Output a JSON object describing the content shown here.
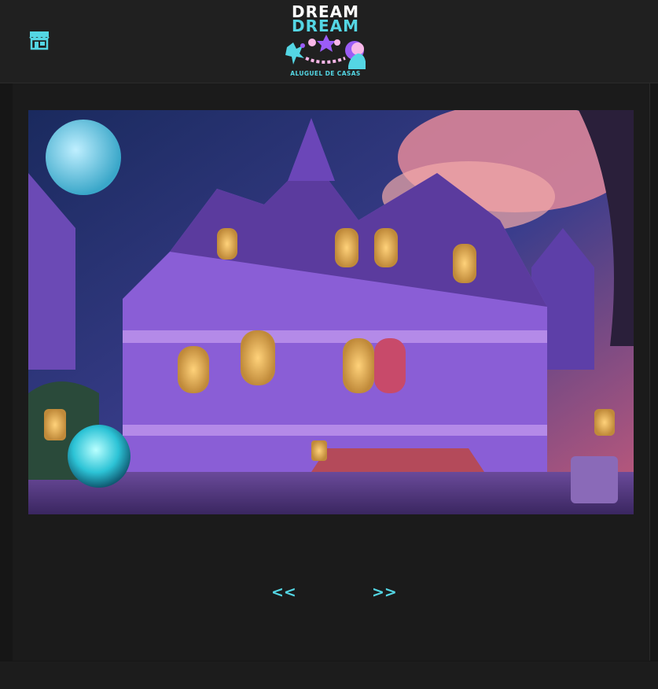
{
  "header": {
    "store_icon": "storefront-icon",
    "logo": {
      "line1": "DREAM",
      "line2": "DREAM",
      "tagline": "ALUGUEL DE CASAS",
      "colors": {
        "primary_text": "#ffffff",
        "accent": "#54d6e4",
        "purple": "#9b5cf6",
        "pink": "#f8b7e8"
      }
    }
  },
  "gallery": {
    "image_icon": "house-photo",
    "prev_label": "<<",
    "next_label": ">>"
  },
  "theme": {
    "accent": "#54d6e4",
    "background": "#161616",
    "header_bg": "#202020"
  }
}
